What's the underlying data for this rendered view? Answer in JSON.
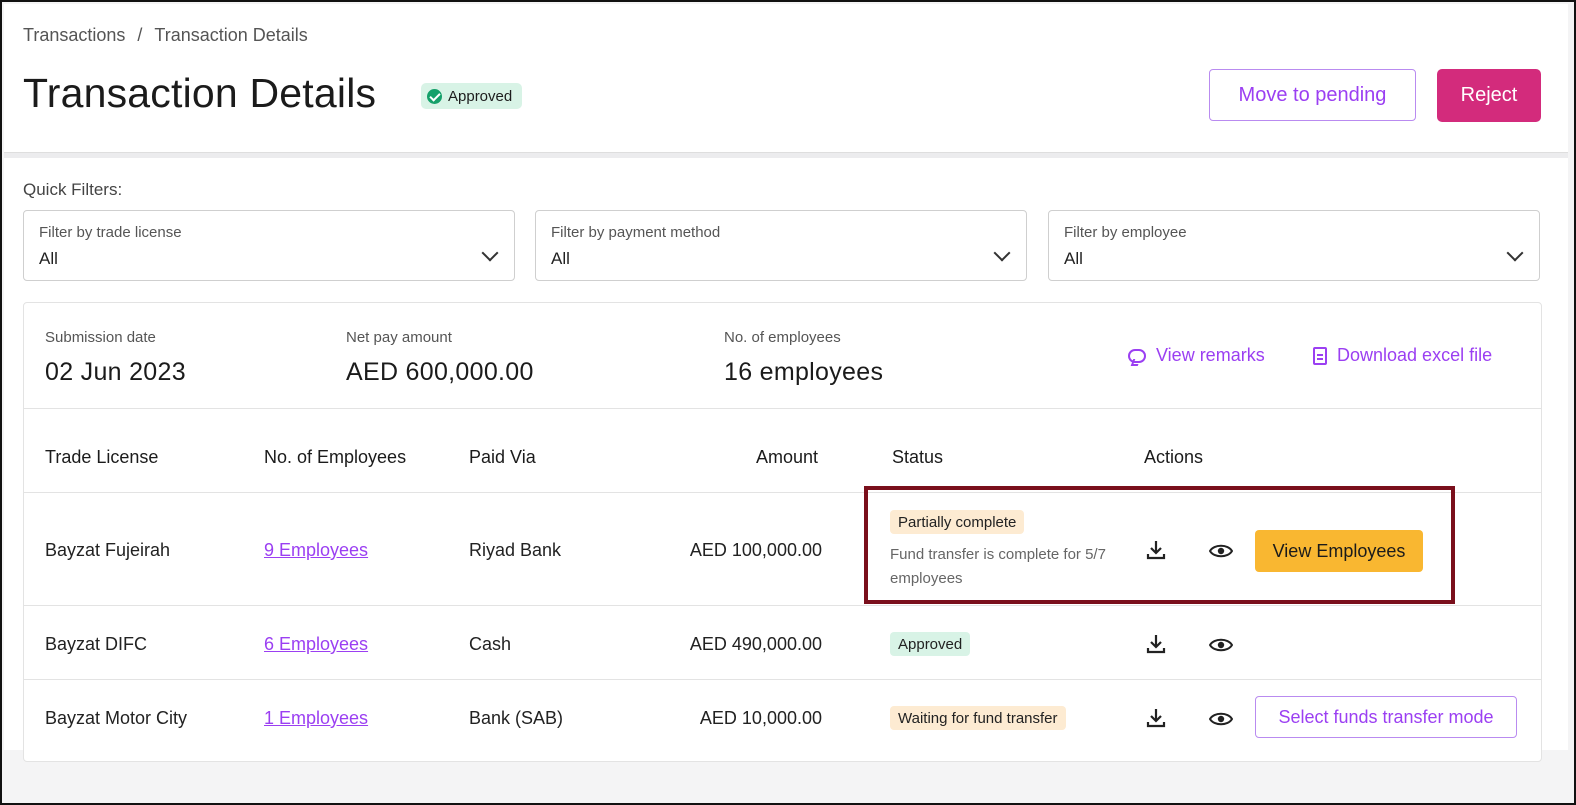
{
  "breadcrumb": {
    "parent": "Transactions",
    "separator": "/",
    "current": "Transaction Details"
  },
  "page": {
    "title": "Transaction Details",
    "status_badge": "Approved"
  },
  "actions": {
    "move_pending": "Move to pending",
    "reject": "Reject"
  },
  "colors": {
    "accent": "#9b3ff2",
    "reject": "#d32b7c",
    "view_employees": "#f9b731",
    "highlight": "#7a0f1c"
  },
  "quick_filters": {
    "label": "Quick Filters:",
    "filters": [
      {
        "label": "Filter by trade license",
        "value": "All"
      },
      {
        "label": "Filter by payment method",
        "value": "All"
      },
      {
        "label": "Filter by employee",
        "value": "All"
      }
    ]
  },
  "summary": {
    "submission_date": {
      "label": "Submission date",
      "value": "02 Jun 2023"
    },
    "net_pay": {
      "label": "Net pay amount",
      "value": "AED 600,000.00"
    },
    "employees": {
      "label": "No. of employees",
      "value": "16 employees"
    },
    "view_remarks": "View remarks",
    "download_excel": "Download excel file"
  },
  "table": {
    "headers": [
      "Trade License",
      "No. of Employees",
      "Paid Via",
      "Amount",
      "Status",
      "Actions"
    ],
    "rows": [
      {
        "trade_license": "Bayzat Fujeirah",
        "employees": "9 Employees",
        "paid_via": "Riyad Bank",
        "amount": "AED 100,000.00",
        "status": "Partially complete",
        "status_note": "Fund transfer is complete for 5/7 employees",
        "action_button": "View Employees"
      },
      {
        "trade_license": "Bayzat DIFC",
        "employees": "6 Employees",
        "paid_via": "Cash",
        "amount": "AED 490,000.00",
        "status": "Approved"
      },
      {
        "trade_license": "Bayzat Motor City",
        "employees": "1 Employees",
        "paid_via": "Bank (SAB)",
        "amount": "AED 10,000.00",
        "status": "Waiting for fund transfer",
        "action_button": "Select funds transfer mode"
      }
    ]
  }
}
